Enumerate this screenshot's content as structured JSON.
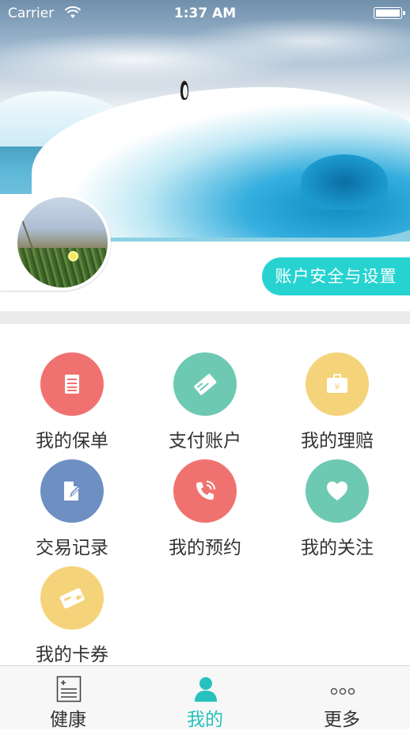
{
  "status_bar": {
    "carrier": "Carrier",
    "time": "1:37 AM",
    "wifi_icon": "wifi-icon",
    "battery_icon": "battery-icon"
  },
  "profile": {
    "settings_label": "账户安全与设置",
    "accent_color": "#27d3d0"
  },
  "grid": {
    "items": [
      {
        "label": "我的保单",
        "icon": "document-icon",
        "color": "#f07270"
      },
      {
        "label": "支付账户",
        "icon": "payment-icon",
        "color": "#6ec9b3"
      },
      {
        "label": "我的理赔",
        "icon": "briefcase-yen-icon",
        "color": "#f5d37a"
      },
      {
        "label": "交易记录",
        "icon": "edit-record-icon",
        "color": "#6e8fc2"
      },
      {
        "label": "我的预约",
        "icon": "phone-icon",
        "color": "#f07270"
      },
      {
        "label": "我的关注",
        "icon": "heart-icon",
        "color": "#6ec9b3"
      },
      {
        "label": "我的卡券",
        "icon": "card-icon",
        "color": "#f5d37a"
      }
    ]
  },
  "tabbar": {
    "tabs": [
      {
        "label": "健康",
        "icon": "health-record-icon",
        "active": false
      },
      {
        "label": "我的",
        "icon": "person-icon",
        "active": true
      },
      {
        "label": "更多",
        "icon": "more-dots-icon",
        "active": false
      }
    ],
    "active_color": "#27c2bd"
  }
}
